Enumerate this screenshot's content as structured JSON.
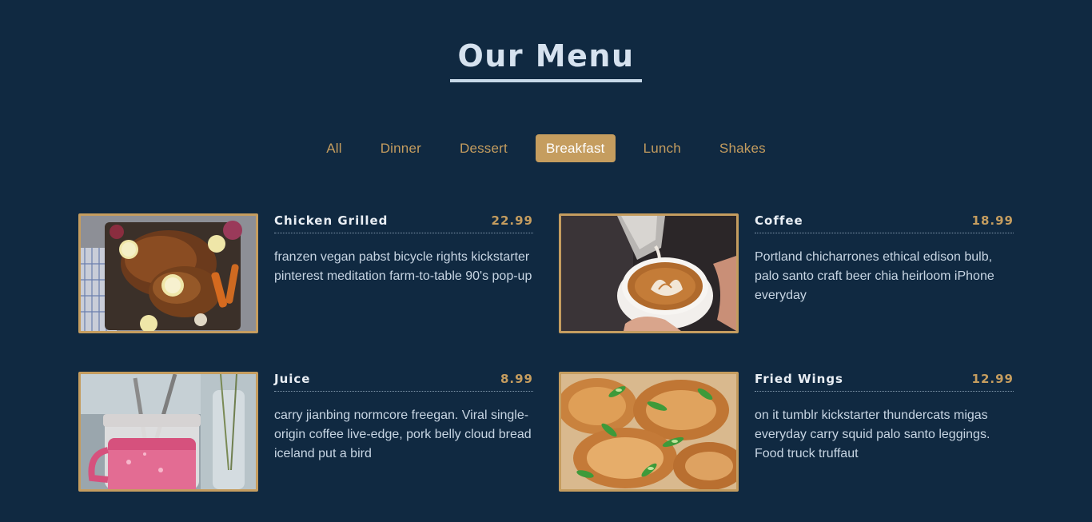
{
  "page": {
    "title": "Our Menu"
  },
  "colors": {
    "background": "#102941",
    "accent": "#c59d5f",
    "title": "#d6e2ef",
    "text": "#c7d5e3"
  },
  "filters": [
    {
      "label": "All",
      "active": false
    },
    {
      "label": "Dinner",
      "active": false
    },
    {
      "label": "Dessert",
      "active": false
    },
    {
      "label": "Breakfast",
      "active": true
    },
    {
      "label": "Lunch",
      "active": false
    },
    {
      "label": "Shakes",
      "active": false
    }
  ],
  "items": [
    {
      "name": "Chicken Grilled",
      "price": "22.99",
      "description": "franzen vegan pabst bicycle rights kickstarter pinterest meditation farm-to-table 90's pop-up",
      "image": "roast-chicken-photo"
    },
    {
      "name": "Coffee",
      "price": "18.99",
      "description": "Portland chicharrones ethical edison bulb, palo santo craft beer chia heirloom iPhone everyday",
      "image": "latte-art-photo"
    },
    {
      "name": "Juice",
      "price": "8.99",
      "description": "carry jianbing normcore freegan. Viral single-origin coffee live-edge, pork belly cloud bread iceland put a bird",
      "image": "pink-juice-jar-photo"
    },
    {
      "name": "Fried Wings",
      "price": "12.99",
      "description": "on it tumblr kickstarter thundercats migas everyday carry squid palo santo leggings. Food truck truffaut",
      "image": "fried-wings-photo"
    }
  ]
}
